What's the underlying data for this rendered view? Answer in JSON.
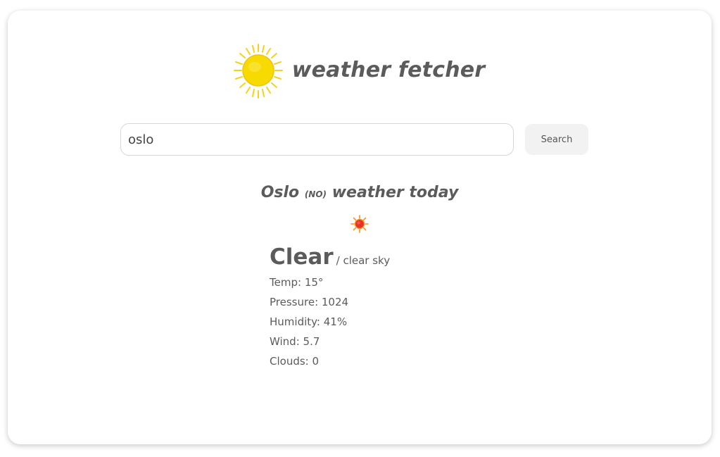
{
  "app": {
    "title": "weather fetcher",
    "logo_icon": "sun-icon"
  },
  "search": {
    "value": "oslo",
    "button_label": "Search"
  },
  "result": {
    "city": "Oslo",
    "country": "(NO)",
    "title_suffix": "weather today",
    "icon": "clear-sky-sun-icon",
    "condition": "Clear",
    "condition_sep": "/",
    "description": "clear sky",
    "stats": [
      {
        "label": "Temp",
        "value": "15°"
      },
      {
        "label": "Pressure",
        "value": "1024"
      },
      {
        "label": "Humidity",
        "value": "41%"
      },
      {
        "label": "Wind",
        "value": "5.7"
      },
      {
        "label": "Clouds",
        "value": "0"
      }
    ]
  },
  "colors": {
    "text": "#5b5b5b",
    "sun": "#f5d90a",
    "button_bg": "#f2f2f2"
  }
}
